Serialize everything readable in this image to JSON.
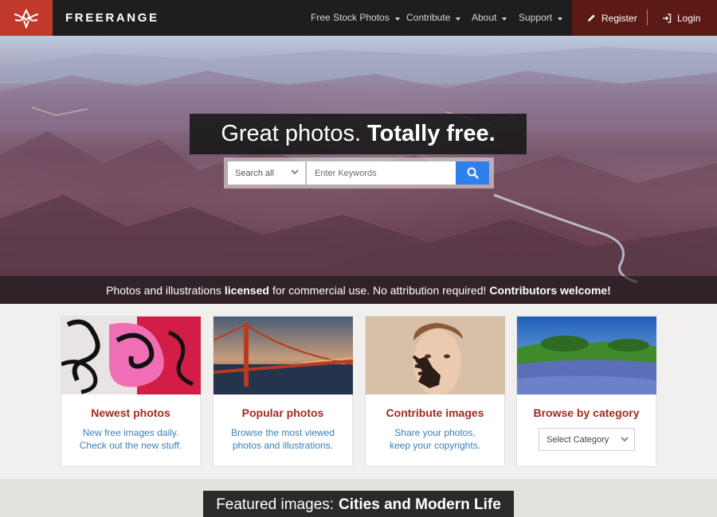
{
  "brand": {
    "name": "FREERANGE",
    "logo": "freerange-bird-logo"
  },
  "nav": {
    "items": [
      {
        "label": "Free Stock Photos"
      },
      {
        "label": "Contribute"
      },
      {
        "label": "About"
      },
      {
        "label": "Support"
      }
    ],
    "register": "Register",
    "login": "Login"
  },
  "hero": {
    "headline_light": "Great photos.",
    "headline_bold": "Totally free.",
    "search": {
      "scope": "Search all",
      "placeholder": "Enter Keywords"
    },
    "tagline": {
      "part1": "Photos and illustrations",
      "bold1": "licensed",
      "part2": "for commercial use. No attribution required!",
      "bold2": "Contributors welcome!"
    }
  },
  "cards": [
    {
      "title": "Newest photos",
      "line1": "New free images daily.",
      "line2": "Check out the new stuff."
    },
    {
      "title": "Popular photos",
      "line1": "Browse the most viewed",
      "line2": "photos and illustrations."
    },
    {
      "title": "Contribute images",
      "line1": "Share your photos,",
      "line2": "keep your copyrights."
    },
    {
      "title": "Browse by category",
      "select": "Select Category"
    }
  ],
  "featured": {
    "prefix": "Featured images:",
    "topic": "Cities and Modern Life"
  },
  "colors": {
    "accent": "#c0392b",
    "auth_bg": "#5c1a14",
    "search_button": "#2f80ed",
    "card_title": "#a12a20",
    "card_text": "#3c7fb8"
  }
}
